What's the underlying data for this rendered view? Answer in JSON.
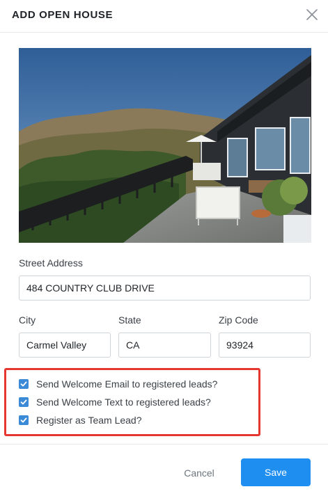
{
  "dialog": {
    "title": "ADD OPEN HOUSE",
    "close_icon": "close-icon"
  },
  "photo": {
    "edit_icon": "edit-icon"
  },
  "form": {
    "street": {
      "label": "Street Address",
      "value": "484 COUNTRY CLUB DRIVE"
    },
    "city": {
      "label": "City",
      "value": "Carmel Valley"
    },
    "state": {
      "label": "State",
      "value": "CA"
    },
    "zip": {
      "label": "Zip Code",
      "value": "93924"
    }
  },
  "options": [
    {
      "label": "Send Welcome Email to registered leads?",
      "checked": true
    },
    {
      "label": "Send Welcome Text to registered leads?",
      "checked": true
    },
    {
      "label": "Register as Team Lead?",
      "checked": true
    }
  ],
  "footer": {
    "cancel_label": "Cancel",
    "save_label": "Save"
  },
  "colors": {
    "accent": "#1f8ef1",
    "checkbox": "#3b8ad8",
    "highlight_border": "#e5372f"
  }
}
